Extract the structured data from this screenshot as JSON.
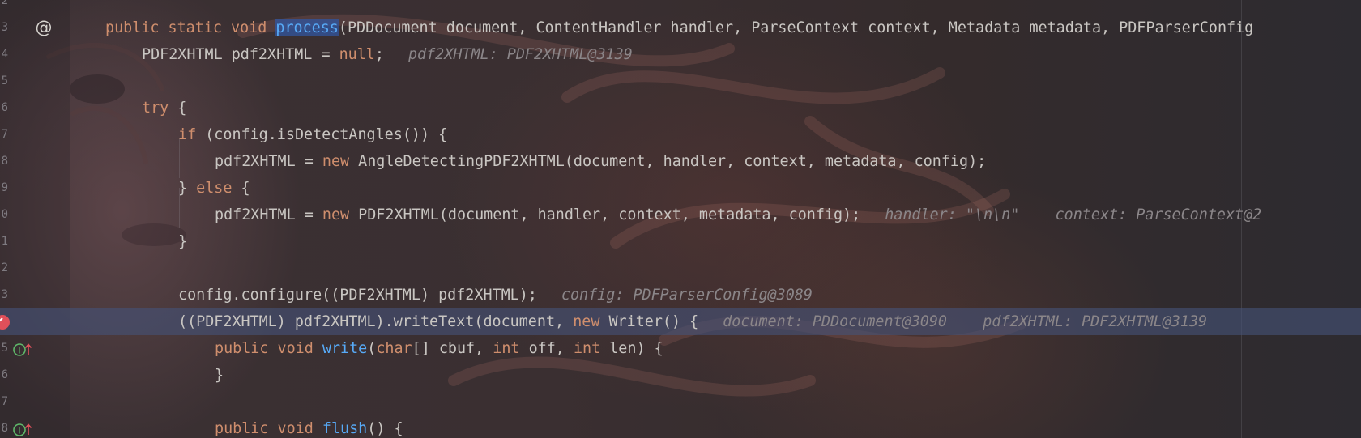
{
  "editor": {
    "lines": [
      {
        "num": "2",
        "tokens": []
      },
      {
        "num": "3",
        "gutter_icon": "at-annotation-icon",
        "tokens": [
          {
            "t": "public static void ",
            "c": "kw"
          },
          {
            "t": "process",
            "c": "fn-sel"
          },
          {
            "t": "(PDDocument document, ContentHandler handler, ParseContext context, Metadata metadata, PDFParserConfig",
            "c": ""
          }
        ]
      },
      {
        "num": "4",
        "tokens": [
          {
            "t": "PDF2XHTML pdf2XHTML = ",
            "c": ""
          },
          {
            "t": "null",
            "c": "kw"
          },
          {
            "t": ";",
            "c": ""
          },
          {
            "t": "pdf2XHTML: PDF2XHTML@3139",
            "c": "hint"
          }
        ]
      },
      {
        "num": "5",
        "tokens": []
      },
      {
        "num": "6",
        "tokens": [
          {
            "t": "try",
            "c": "kw"
          },
          {
            "t": " {",
            "c": ""
          }
        ]
      },
      {
        "num": "7",
        "tokens": [
          {
            "t": "if",
            "c": "kw"
          },
          {
            "t": " (config.isDetectAngles()) {",
            "c": ""
          }
        ]
      },
      {
        "num": "8",
        "tokens": [
          {
            "t": "pdf2XHTML = ",
            "c": ""
          },
          {
            "t": "new",
            "c": "kw"
          },
          {
            "t": " AngleDetectingPDF2XHTML(document, handler, context, metadata, config);",
            "c": ""
          }
        ]
      },
      {
        "num": "9",
        "tokens": [
          {
            "t": "} ",
            "c": ""
          },
          {
            "t": "else",
            "c": "kw"
          },
          {
            "t": " {",
            "c": ""
          }
        ]
      },
      {
        "num": "0",
        "tokens": [
          {
            "t": "pdf2XHTML = ",
            "c": ""
          },
          {
            "t": "new",
            "c": "kw"
          },
          {
            "t": " PDF2XHTML(document, handler, context, metadata, config);",
            "c": ""
          },
          {
            "t": "handler: \"\\n\\n\"    context: ParseContext@2",
            "c": "hint"
          }
        ]
      },
      {
        "num": "1",
        "tokens": [
          {
            "t": "}",
            "c": ""
          }
        ]
      },
      {
        "num": "2",
        "tokens": []
      },
      {
        "num": "3",
        "tokens": [
          {
            "t": "config.configure((PDF2XHTML) pdf2XHTML);",
            "c": ""
          },
          {
            "t": "config: PDFParserConfig@3089",
            "c": "hint"
          }
        ]
      },
      {
        "num": "",
        "gutter_icon": "breakpoint-check-icon",
        "current": true,
        "tokens": [
          {
            "t": "((PDF2XHTML) pdf2XHTML).writeText(document, ",
            "c": ""
          },
          {
            "t": "new",
            "c": "kw"
          },
          {
            "t": " Writer() {",
            "c": ""
          },
          {
            "t": "document: PDDocument@3090    pdf2XHTML: PDF2XHTML@3139",
            "c": "hint"
          }
        ]
      },
      {
        "num": "5",
        "gutter_icon": "implements-icon",
        "tokens": [
          {
            "t": "public void ",
            "c": "kw"
          },
          {
            "t": "write",
            "c": "fn"
          },
          {
            "t": "(",
            "c": ""
          },
          {
            "t": "char",
            "c": "kw"
          },
          {
            "t": "[] cbuf, ",
            "c": ""
          },
          {
            "t": "int",
            "c": "kw"
          },
          {
            "t": " off, ",
            "c": ""
          },
          {
            "t": "int",
            "c": "kw"
          },
          {
            "t": " len) {",
            "c": ""
          }
        ]
      },
      {
        "num": "6",
        "tokens": [
          {
            "t": "}",
            "c": ""
          }
        ]
      },
      {
        "num": "7",
        "tokens": []
      },
      {
        "num": "8",
        "gutter_icon": "implements-icon",
        "tokens": [
          {
            "t": "public void ",
            "c": "kw"
          },
          {
            "t": "flush",
            "c": "fn"
          },
          {
            "t": "() {",
            "c": ""
          }
        ]
      }
    ]
  },
  "colors": {
    "keyword": "#cf8e6d",
    "method": "#57aaf7",
    "text": "#c9c6c2",
    "hint": "#8b8689",
    "breakpoint": "#e0505a",
    "implements_icon": "#5fb86a"
  }
}
